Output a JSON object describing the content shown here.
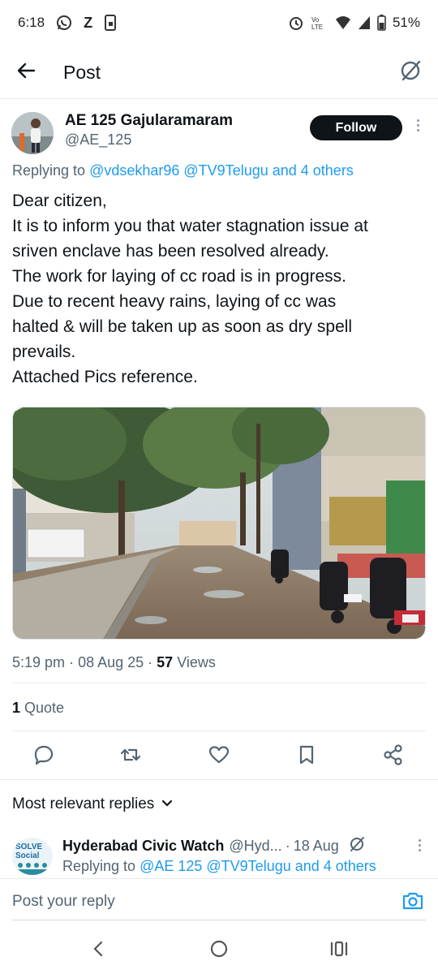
{
  "status_bar": {
    "time": "6:18",
    "left_icons": [
      "whatsapp-icon",
      "z-app-icon",
      "phone-app-icon"
    ],
    "right_icons": [
      "alarm-icon",
      "volte-icon",
      "wifi-icon",
      "signal-icon",
      "battery-icon"
    ],
    "battery": "51%"
  },
  "header": {
    "back_icon": "arrow-left-icon",
    "title": "Post",
    "grok_icon": "grok-icon"
  },
  "post": {
    "author_name": "AE 125 Gajularamaram",
    "author_handle": "@AE_125",
    "follow_label": "Follow",
    "replying_prefix": "Replying to",
    "replying_to": "@vdsekhar96 @TV9Telugu and 4 others",
    "text_lines": [
      "Dear citizen,",
      "It is to inform you that water stagnation issue at",
      "sriven enclave has been resolved already.",
      "The work for laying of cc road is in progress.",
      "Due to recent heavy rains, laying of cc was",
      "halted & will be taken up as soon as dry spell",
      "prevails.",
      "Attached Pics reference."
    ],
    "media_description": "street-photo",
    "time": "5:19 pm",
    "date": "08 Aug 25",
    "views_count": "57",
    "views_label": "Views",
    "quotes_count": "1",
    "quotes_label": "Quote"
  },
  "actions": {
    "reply_icon": "reply-icon",
    "repost_icon": "repost-icon",
    "like_icon": "heart-icon",
    "bookmark_icon": "bookmark-icon",
    "share_icon": "share-icon"
  },
  "replies": {
    "sort_label": "Most relevant replies",
    "items": [
      {
        "name": "Hyderabad Civic Watch",
        "handle": "@Hyd...",
        "date": "18 Aug",
        "replying_prefix": "Replying to",
        "replying_to": "@AE 125 @TV9Telugu and 4 others",
        "avatar_text": "SOLVE Social"
      }
    ]
  },
  "compose": {
    "placeholder": "Post your reply"
  },
  "colors": {
    "accent": "#1d9bf0",
    "text_primary": "#0f1419",
    "text_secondary": "#536471"
  }
}
